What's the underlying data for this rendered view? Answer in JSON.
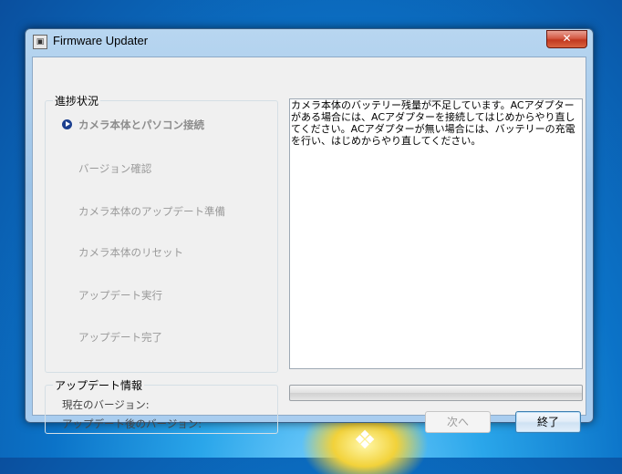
{
  "window": {
    "title": "Firmware Updater",
    "close_label": "✕"
  },
  "progress": {
    "legend": "進捗状況",
    "steps": [
      {
        "label": "カメラ本体とパソコン接続",
        "active": true
      },
      {
        "label": "バージョン確認",
        "active": false
      },
      {
        "label": "カメラ本体のアップデート準備",
        "active": false
      },
      {
        "label": "カメラ本体のリセット",
        "active": false
      },
      {
        "label": "アップデート実行",
        "active": false
      },
      {
        "label": "アップデート完了",
        "active": false
      }
    ]
  },
  "info": {
    "legend": "アップデート情報",
    "current_version_label": "現在のバージョン:",
    "updated_version_label": "アップデート後のバージョン:"
  },
  "message": {
    "text": "カメラ本体のバッテリー残量が不足しています。ACアダプターがある場合には、ACアダプターを接続してはじめからやり直してください。ACアダプターが無い場合には、バッテリーの充電を行い、はじめからやり直してください。"
  },
  "progress_bar": {
    "value": 0
  },
  "buttons": {
    "next": "次へ",
    "end": "終了"
  }
}
